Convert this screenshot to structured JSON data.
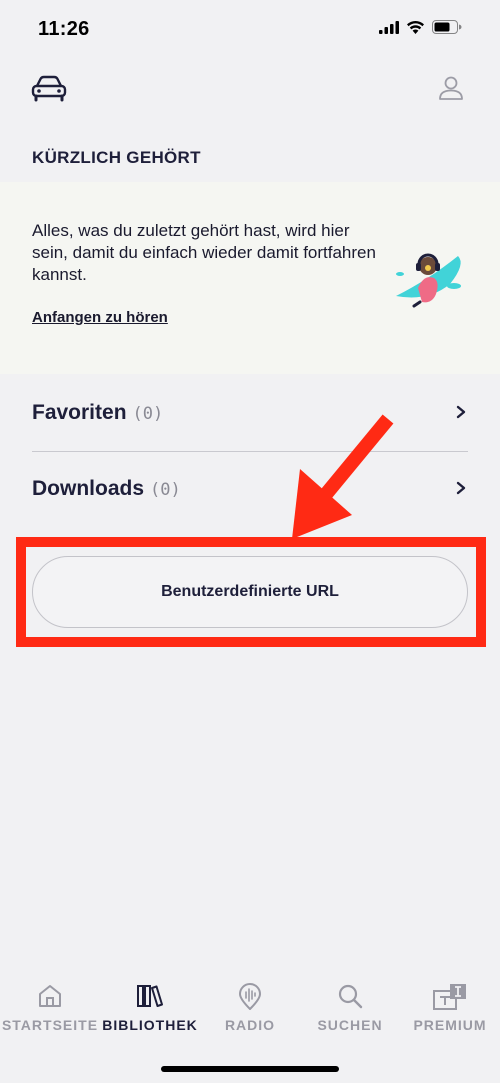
{
  "status_bar": {
    "time": "11:26"
  },
  "header": {
    "car_icon": "car-icon",
    "profile_icon": "profile-icon"
  },
  "recent": {
    "title": "KÜRZLICH GEHÖRT",
    "description": "Alles, was du zuletzt gehört hast, wird hier sein, damit du einfach wieder damit fortfahren kannst.",
    "link_label": "Anfangen zu hören"
  },
  "library": {
    "favorites": {
      "label": "Favoriten",
      "count": "(0)"
    },
    "downloads": {
      "label": "Downloads",
      "count": "(0)"
    }
  },
  "custom_url": {
    "label": "Benutzerdefinierte URL"
  },
  "annotation": {
    "arrow_color": "#ff2a14",
    "box_color": "#ff2a14"
  },
  "tabs": [
    {
      "label": "STARTSEITE",
      "icon": "home-icon",
      "active": false
    },
    {
      "label": "BIBLIOTHEK",
      "icon": "library-icon",
      "active": true
    },
    {
      "label": "RADIO",
      "icon": "radio-icon",
      "active": false
    },
    {
      "label": "SUCHEN",
      "icon": "search-icon",
      "active": false
    },
    {
      "label": "PREMIUM",
      "icon": "premium-icon",
      "active": false
    }
  ]
}
